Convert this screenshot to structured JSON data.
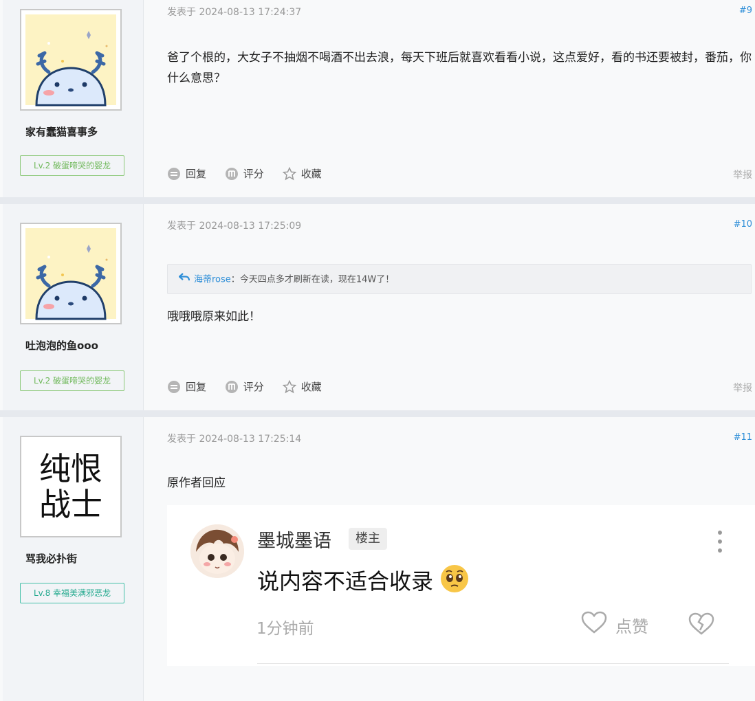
{
  "posts": [
    {
      "username": "家有蠢猫喜事多",
      "level": "Lv.2 破蛋啼哭的婴龙",
      "posted": "发表于 2024-08-13 17:24:37",
      "floor": "#9",
      "content": "爸了个根的，大女子不抽烟不喝酒不出去浪，每天下班后就喜欢看看小说，这点爱好，看的书还要被封，番茄，你什么意思？",
      "actions": {
        "reply": "回复",
        "rate": "评分",
        "favorite": "收藏",
        "report": "举报"
      }
    },
    {
      "username": "吐泡泡的鱼ooo",
      "level": "Lv.2 破蛋啼哭的婴龙",
      "posted": "发表于 2024-08-13 17:25:09",
      "floor": "#10",
      "quote": {
        "author": "海蒂rose",
        "sep": "：",
        "text": "今天四点多才刷新在读，现在14W了！"
      },
      "content": "哦哦哦原来如此！",
      "actions": {
        "reply": "回复",
        "rate": "评分",
        "favorite": "收藏",
        "report": "举报"
      }
    },
    {
      "username": "骂我必扑街",
      "avatar_text": [
        "纯恨",
        "战士"
      ],
      "level": "Lv.8 幸福美满邪恶龙",
      "posted": "发表于 2024-08-13 17:25:14",
      "floor": "#11",
      "content": "原作者回应",
      "embed": {
        "author": "墨城墨语",
        "tag": "楼主",
        "text": "说内容不适合收录",
        "time": "1分钟前",
        "like": "点赞"
      }
    }
  ],
  "colors": {
    "link": "#2f8fd8",
    "level_green": "#6fb85a",
    "level_teal": "#23a98e"
  }
}
